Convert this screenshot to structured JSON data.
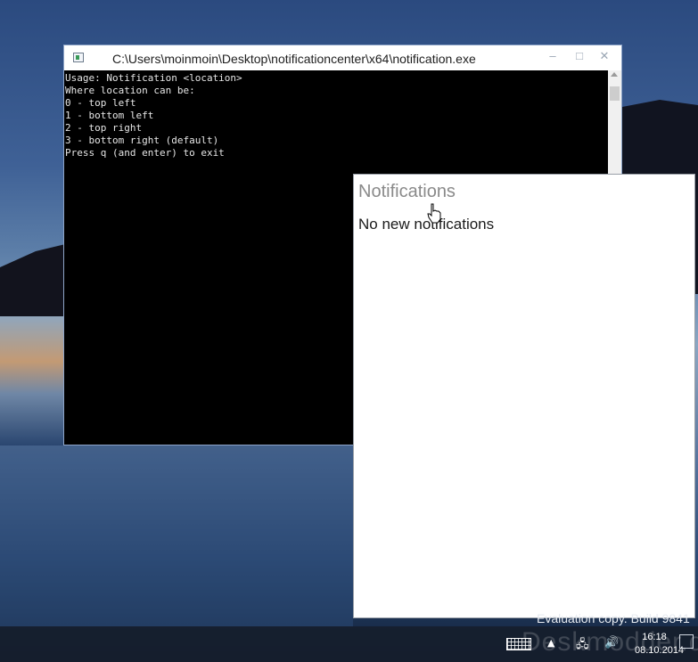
{
  "desktop": {
    "evaluation_text": "Evaluation copy. Build 9841",
    "watermark": "Deskmodder.de"
  },
  "console": {
    "title": "C:\\Users\\moinmoin\\Desktop\\notificationcenter\\x64\\notification.exe",
    "buttons": {
      "minimize": "–",
      "maximize": "□",
      "close": "✕"
    },
    "lines": [
      "Usage: Notification <location>",
      "Where location can be:",
      "0 - top left",
      "1 - bottom left",
      "2 - top right",
      "3 - bottom right (default)",
      "Press q (and enter) to exit"
    ]
  },
  "notifications": {
    "title": "Notifications",
    "empty_message": "No new notifications"
  },
  "taskbar": {
    "icons": [
      "keyboard-icon",
      "chevron-up-icon",
      "network-icon",
      "volume-icon",
      "notification-icon"
    ],
    "chevron": "▲",
    "network": "🖧",
    "volume": "🔊",
    "time": "16:18",
    "date": "08.10.2014"
  }
}
